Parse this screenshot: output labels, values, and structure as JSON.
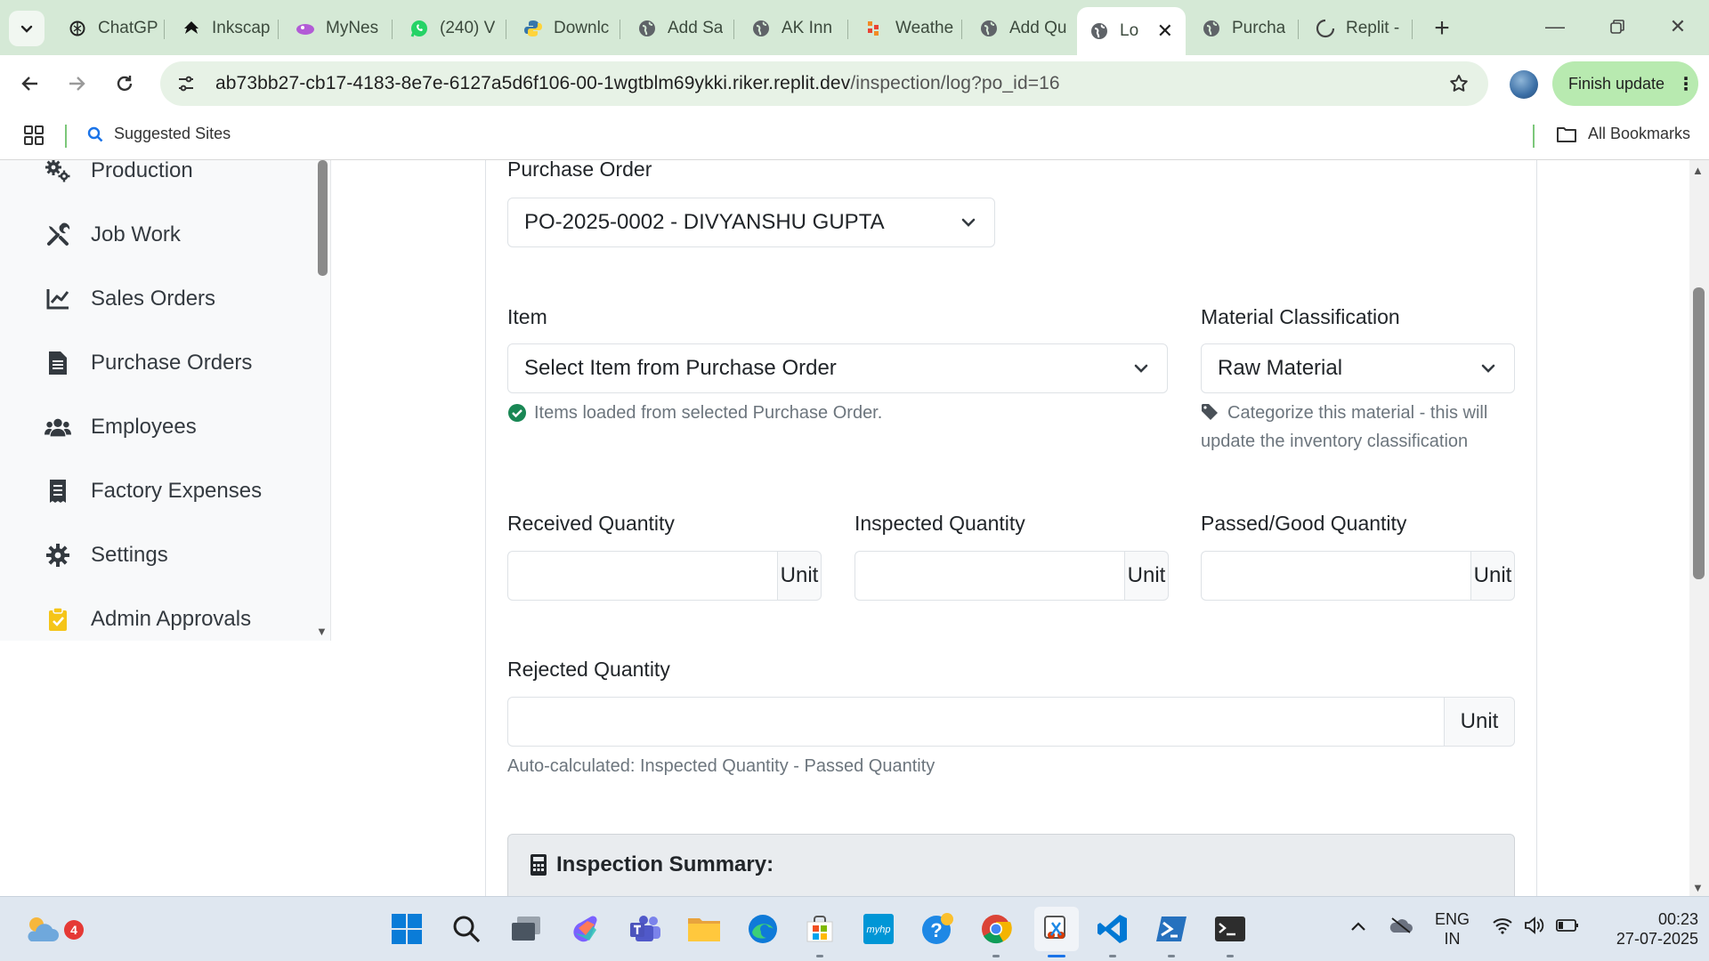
{
  "browser": {
    "tabs": [
      {
        "title": "ChatGP",
        "icon": "openai-icon"
      },
      {
        "title": "Inkscap",
        "icon": "inkscape-icon"
      },
      {
        "title": "MyNes",
        "icon": "mynest-icon"
      },
      {
        "title": "(240) V",
        "icon": "whatsapp-icon"
      },
      {
        "title": "Downlc",
        "icon": "python-icon"
      },
      {
        "title": "Add Sa",
        "icon": "globe-icon"
      },
      {
        "title": "AK Inn",
        "icon": "globe-icon"
      },
      {
        "title": "Weathe",
        "icon": "weather-icon"
      },
      {
        "title": "Add Qu",
        "icon": "globe-icon"
      },
      {
        "title": "Lo",
        "icon": "globe-icon",
        "active": true
      },
      {
        "title": "Purcha",
        "icon": "globe-icon"
      },
      {
        "title": "Replit -",
        "icon": "loading-icon"
      }
    ],
    "url_main": "ab73bb27-cb17-4183-8e7e-6127a5d6f106-00-1wgtblm69ykki.riker.replit.dev",
    "url_path": "/inspection/log?po_id=16",
    "finish_update_label": "Finish update",
    "bookmarks": {
      "suggested_sites": "Suggested Sites",
      "all_bookmarks": "All Bookmarks"
    }
  },
  "sidebar": {
    "items": [
      {
        "label": "Production",
        "icon": "cogs-icon"
      },
      {
        "label": "Job Work",
        "icon": "tools-icon"
      },
      {
        "label": "Sales Orders",
        "icon": "chart-line-icon"
      },
      {
        "label": "Purchase Orders",
        "icon": "file-invoice-icon"
      },
      {
        "label": "Employees",
        "icon": "users-icon"
      },
      {
        "label": "Factory Expenses",
        "icon": "receipt-icon"
      },
      {
        "label": "Settings",
        "icon": "gear-icon"
      },
      {
        "label": "Admin Approvals",
        "icon": "clipboard-check-icon"
      }
    ]
  },
  "form": {
    "purchase_order": {
      "label": "Purchase Order",
      "selected": "PO-2025-0002 - DIVYANSHU GUPTA"
    },
    "item": {
      "label": "Item",
      "selected": "Select Item from Purchase Order",
      "helper": "Items loaded from selected Purchase Order."
    },
    "material_classification": {
      "label": "Material Classification",
      "selected": "Raw Material",
      "helper_line1": "Categorize this material - this will",
      "helper_line2": "update the inventory classification"
    },
    "received_quantity": {
      "label": "Received Quantity",
      "value": "",
      "unit": "Unit"
    },
    "inspected_quantity": {
      "label": "Inspected Quantity",
      "value": "",
      "unit": "Unit"
    },
    "passed_quantity": {
      "label": "Passed/Good Quantity",
      "value": "",
      "unit": "Unit"
    },
    "rejected_quantity": {
      "label": "Rejected Quantity",
      "value": "",
      "unit": "Unit",
      "helper": "Auto-calculated: Inspected Quantity - Passed Quantity"
    },
    "summary_title": "Inspection Summary:"
  },
  "taskbar": {
    "weather_badge": "4",
    "lang_line1": "ENG",
    "lang_line2": "IN",
    "time": "00:23",
    "date": "27-07-2025"
  },
  "colors": {
    "success": "#198754",
    "tab_bar": "#d5e9d6",
    "finish_update": "#b8eab0"
  }
}
